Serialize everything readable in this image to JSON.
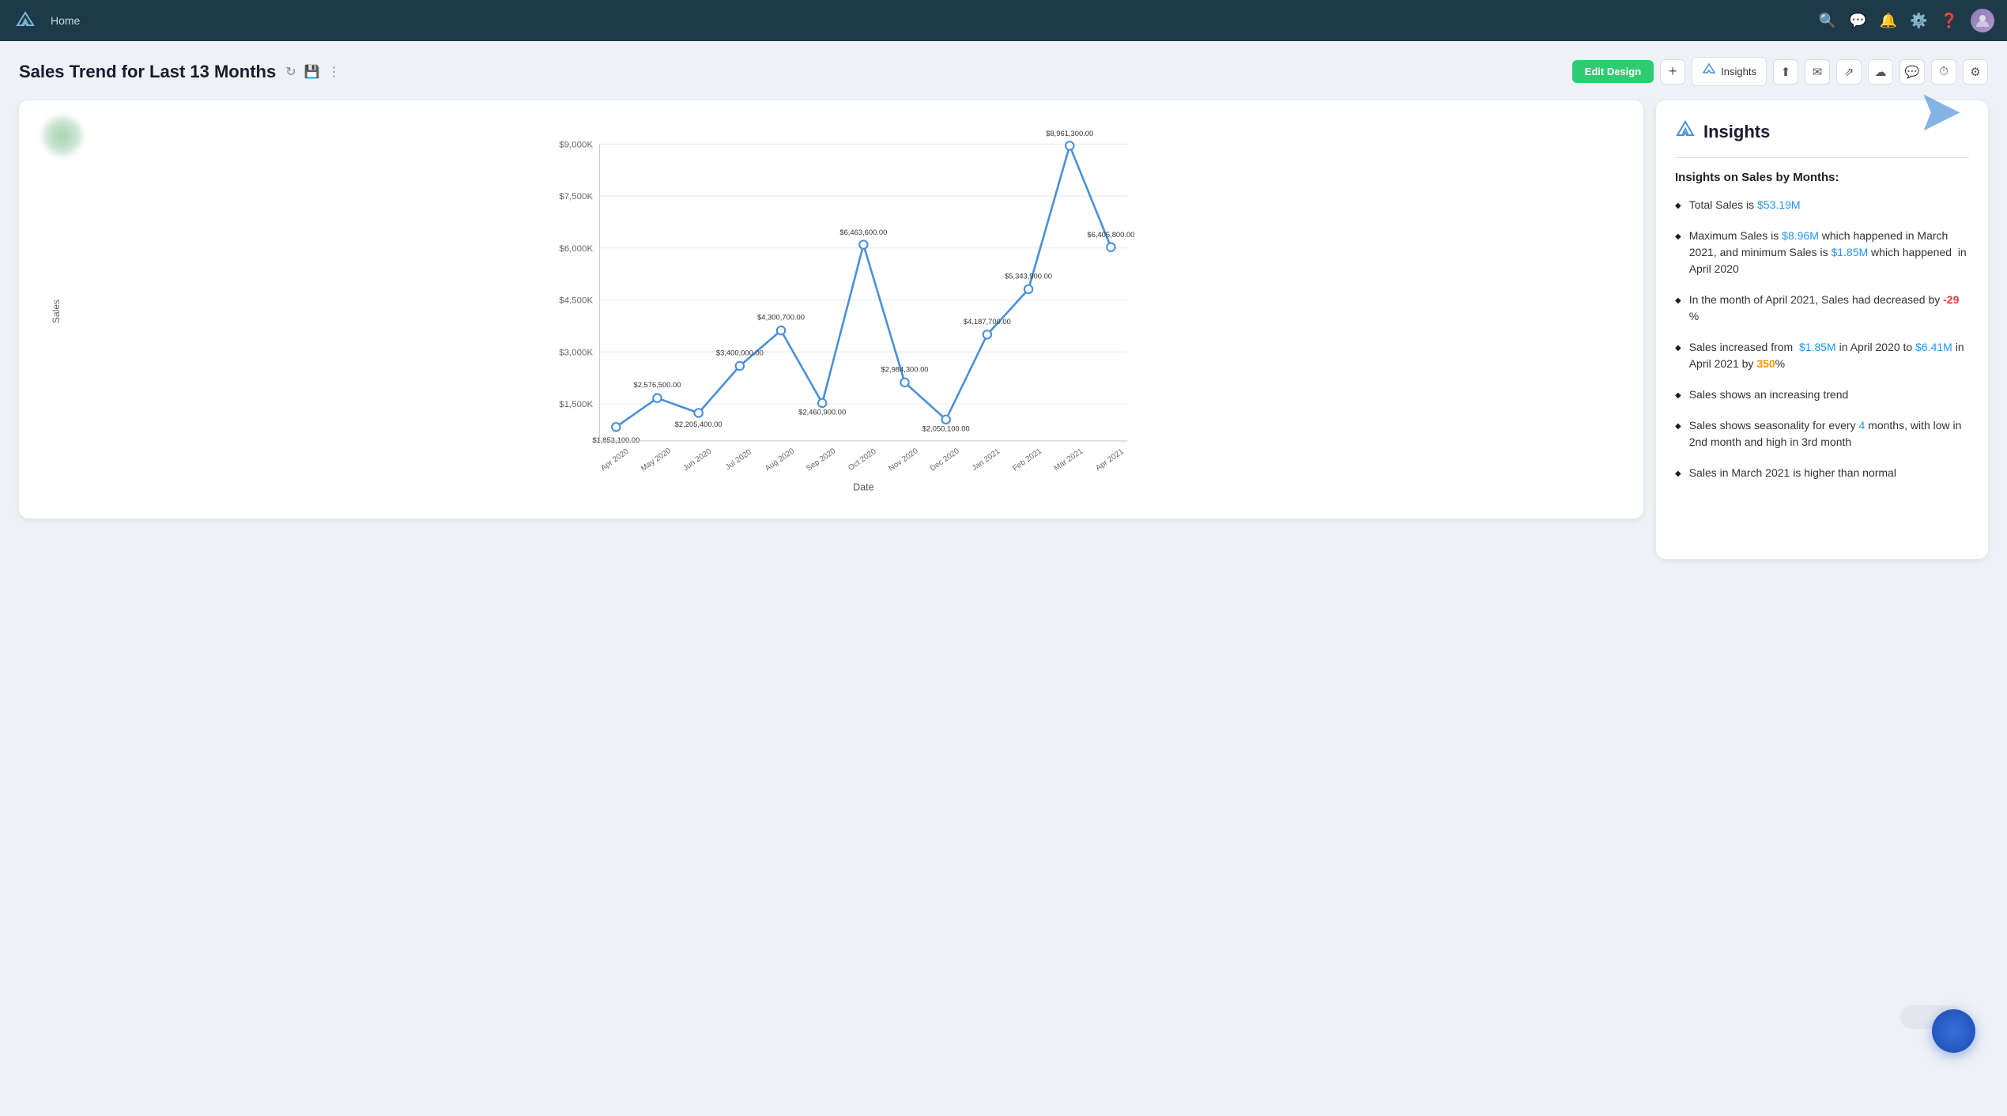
{
  "topnav": {
    "home_label": "Home",
    "icons": [
      "search",
      "chat",
      "bell",
      "tools",
      "help"
    ]
  },
  "page": {
    "title": "Sales Trend for Last 13 Months",
    "toolbar": {
      "edit_design_label": "Edit Design",
      "add_label": "+",
      "insights_label": "Insights"
    }
  },
  "chart": {
    "y_axis_label": "Sales",
    "x_axis_label": "Date",
    "y_ticks": [
      "$1,500K",
      "$3,000K",
      "$4,500K",
      "$6,000K",
      "$7,500K",
      "$9,000K"
    ],
    "x_ticks": [
      "Apr 2020",
      "May 2020",
      "Jun 2020",
      "Jul 2020",
      "Aug 2020",
      "Sep 2020",
      "Oct 2020",
      "Nov 2020",
      "Dec 2020",
      "Jan 2021",
      "Feb 2021",
      "Mar 2021",
      "Apr 2021"
    ],
    "data_points": [
      {
        "label": "Apr 2020",
        "value": 1853100,
        "display": "$1,853,100.00"
      },
      {
        "label": "May 2020",
        "value": 2576500,
        "display": "$2,576,500.00"
      },
      {
        "label": "Jun 2020",
        "value": 2205400,
        "display": "$2,205,400.00"
      },
      {
        "label": "Jul 2020",
        "value": 3400000,
        "display": "$3,400,000.00"
      },
      {
        "label": "Aug 2020",
        "value": 4300700,
        "display": "$4,300,700.00"
      },
      {
        "label": "Sep 2020",
        "value": 2460900,
        "display": "$2,460,900.00"
      },
      {
        "label": "Oct 2020",
        "value": 6463600,
        "display": "$6,463,600.00"
      },
      {
        "label": "Nov 2020",
        "value": 2984300,
        "display": "$2,984,300.00"
      },
      {
        "label": "Dec 2020",
        "value": 2050100,
        "display": "$2,050,100.00"
      },
      {
        "label": "Jan 2021",
        "value": 4187700,
        "display": "$4,187,700.00"
      },
      {
        "label": "Feb 2021",
        "value": 5343900,
        "display": "$5,343,900.00"
      },
      {
        "label": "Mar 2021",
        "value": 8961300,
        "display": "$8,961,300.00"
      },
      {
        "label": "Apr 2021",
        "value": 6405800,
        "display": "$6,405,800.00"
      }
    ]
  },
  "insights": {
    "panel_title": "Insights",
    "section_title": "Insights on Sales by Months:",
    "items": [
      {
        "id": 1,
        "text_parts": [
          {
            "text": "Total Sales is ",
            "type": "normal"
          },
          {
            "text": "$53.19M",
            "type": "blue"
          }
        ]
      },
      {
        "id": 2,
        "text_parts": [
          {
            "text": "Maximum Sales is ",
            "type": "normal"
          },
          {
            "text": "$8.96M",
            "type": "blue"
          },
          {
            "text": " which happened in March 2021, and minimum Sales is ",
            "type": "normal"
          },
          {
            "text": "$1.85M",
            "type": "blue"
          },
          {
            "text": " which happened  in April 2020",
            "type": "normal"
          }
        ]
      },
      {
        "id": 3,
        "text_parts": [
          {
            "text": "In the month of April 2021, Sales had decreased by ",
            "type": "normal"
          },
          {
            "text": "-29",
            "type": "red"
          },
          {
            "text": " %",
            "type": "normal"
          }
        ]
      },
      {
        "id": 4,
        "text_parts": [
          {
            "text": "Sales increased from  ",
            "type": "normal"
          },
          {
            "text": "$1.85M",
            "type": "blue"
          },
          {
            "text": " in April 2020 to ",
            "type": "normal"
          },
          {
            "text": "$6.41M",
            "type": "blue"
          },
          {
            "text": " in April 2021 by ",
            "type": "normal"
          },
          {
            "text": "350",
            "type": "orange"
          },
          {
            "text": "%",
            "type": "normal"
          }
        ]
      },
      {
        "id": 5,
        "text_parts": [
          {
            "text": "Sales shows an increasing trend",
            "type": "normal"
          }
        ]
      },
      {
        "id": 6,
        "text_parts": [
          {
            "text": "Sales shows seasonality for every ",
            "type": "normal"
          },
          {
            "text": "4",
            "type": "blue"
          },
          {
            "text": " months, with low in ",
            "type": "normal"
          },
          {
            "text": "2nd",
            "type": "normal"
          },
          {
            "text": " month and high in 3rd month",
            "type": "normal"
          }
        ]
      },
      {
        "id": 7,
        "text_parts": [
          {
            "text": "Sales in March 2021 is higher than normal",
            "type": "normal"
          }
        ]
      }
    ]
  }
}
